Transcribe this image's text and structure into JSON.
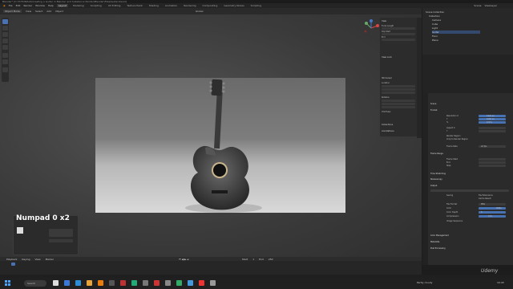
{
  "window": {
    "title": "Blender* [C:\\TUTORIALS\\Creating a Guitar in Blender and Substance Painter\\Blender\\Files\\Guitar.blend]"
  },
  "menu": {
    "items": [
      "File",
      "Edit",
      "Render",
      "Window",
      "Help"
    ],
    "tabs": [
      "Layout",
      "Modeling",
      "Sculpting",
      "UV Editing",
      "Texture Paint",
      "Shading",
      "Animation",
      "Rendering",
      "Compositing",
      "Geometry Nodes",
      "Scripting"
    ],
    "active_tab": "Layout",
    "scene": "Scene",
    "view_layer": "ViewLayer"
  },
  "viewport_header": {
    "mode": "Object Mode",
    "items": [
      "View",
      "Select",
      "Add",
      "Object"
    ],
    "transform": "Global"
  },
  "overlay_text": {
    "numpad": "Numpad 0 x2"
  },
  "n_panel": {
    "sections": [
      "View",
      "View Lock",
      "3D Cursor",
      "Collections",
      "Annotations"
    ],
    "labels": [
      "Focal Length",
      "Clip Start",
      "End",
      "Location",
      "Rotation",
      "XYZ Euler"
    ]
  },
  "outliner": {
    "items": [
      "Scene Collection",
      "Collection",
      "Camera",
      "Cube",
      "Light",
      "Guitar",
      "Floor",
      "Plane"
    ]
  },
  "properties": {
    "sections": [
      "Scene",
      "Format",
      "Frame Range",
      "Time Stretching",
      "Stereoscopy",
      "Output",
      "Color Management",
      "Metadata",
      "Post Processing"
    ],
    "labels": [
      "Resolution X",
      "Y",
      "%",
      "Aspect X",
      "Y",
      "Render Region",
      "Crop to Render Region",
      "Frame Rate",
      "Frame Start",
      "End",
      "Step",
      "Saving",
      "File Extensions",
      "Cache Result",
      "File Format",
      "Color",
      "Color Depth",
      "Compression",
      "Image Sequence"
    ],
    "values": [
      "1920 px",
      "1080 px",
      "100%",
      "1.000",
      "1.000",
      "24 fps",
      "1",
      "250",
      "1",
      "PNG",
      "RGBA",
      "8",
      "15%"
    ]
  },
  "timeline": {
    "items": [
      "Playback",
      "Keying",
      "View",
      "Marker"
    ],
    "start_label": "Start",
    "start": "1",
    "end_label": "End",
    "end": "250"
  },
  "taskbar": {
    "search": "Search",
    "weather": "Partly cloudy",
    "time": "10:43"
  },
  "watermark": "Udemy",
  "colors": {
    "accent": "#4772b3",
    "viewport": "#3d3d3d",
    "panel": "#2b2b2b"
  },
  "icons": [
    "blender-logo-icon",
    "cursor-icon",
    "move-icon",
    "rotate-icon",
    "scale-icon",
    "camera-icon",
    "eye-icon",
    "windows-start-icon"
  ]
}
